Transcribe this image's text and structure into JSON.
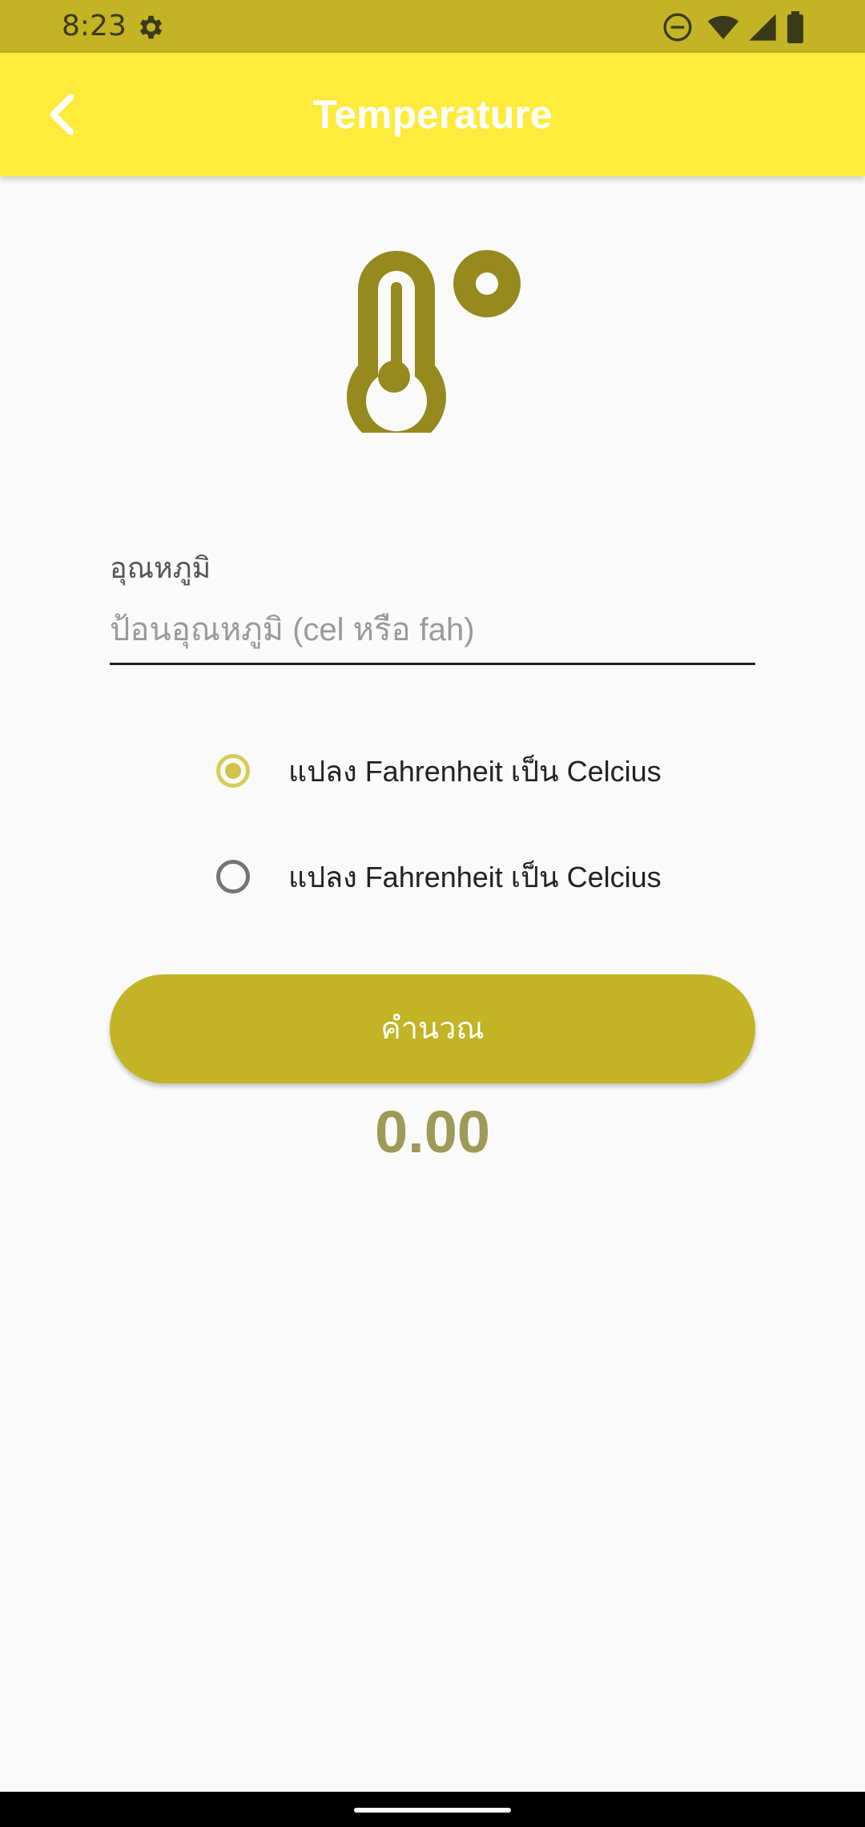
{
  "status_bar": {
    "time": "8:23",
    "icons": [
      "settings-icon",
      "do-not-disturb-icon",
      "wifi-icon",
      "signal-icon",
      "battery-icon"
    ]
  },
  "app_bar": {
    "title": "Temperature",
    "back_icon": "back-arrow-icon"
  },
  "header_icon": "thermometer-degree-icon",
  "form": {
    "label": "อุณหภูมิ",
    "placeholder": "ป้อนอุณหภูมิ (cel หรือ fah)",
    "value": ""
  },
  "options": [
    {
      "label": "แปลง Fahrenheit เป็น Celcius",
      "selected": true
    },
    {
      "label": "แปลง Fahrenheit เป็น Celcius",
      "selected": false
    }
  ],
  "calculate_button": "คำนวณ",
  "result": "0.00",
  "colors": {
    "status_bar": "#c2b424",
    "app_bar": "#ffeb3b",
    "accent": "#c2b424",
    "icon": "#968a1e",
    "result_text": "#9e9a57"
  }
}
